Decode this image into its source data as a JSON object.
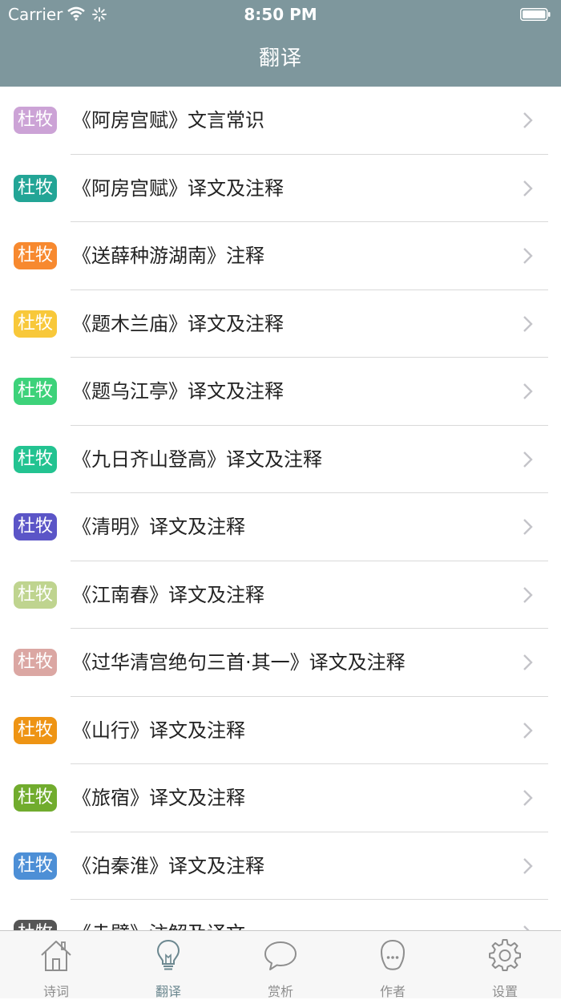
{
  "status_bar": {
    "carrier": "Carrier",
    "time": "8:50 PM"
  },
  "nav": {
    "title": "翻译"
  },
  "list": [
    {
      "tag": "杜牧",
      "color": "#cca3d6",
      "title": "《阿房宫赋》文言常识"
    },
    {
      "tag": "杜牧",
      "color": "#23a596",
      "title": "《阿房宫赋》译文及注释"
    },
    {
      "tag": "杜牧",
      "color": "#f7892f",
      "title": "《送薛种游湖南》注释"
    },
    {
      "tag": "杜牧",
      "color": "#f8c83a",
      "title": "《题木兰庙》译文及注释"
    },
    {
      "tag": "杜牧",
      "color": "#3dd27a",
      "title": "《题乌江亭》译文及注释"
    },
    {
      "tag": "杜牧",
      "color": "#23c391",
      "title": "《九日齐山登高》译文及注释"
    },
    {
      "tag": "杜牧",
      "color": "#5b55c7",
      "title": "《清明》译文及注释"
    },
    {
      "tag": "杜牧",
      "color": "#bfd48f",
      "title": "《江南春》译文及注释"
    },
    {
      "tag": "杜牧",
      "color": "#dba7a3",
      "title": "《过华清宫绝句三首·其一》译文及注释"
    },
    {
      "tag": "杜牧",
      "color": "#ee9414",
      "title": "《山行》译文及注释"
    },
    {
      "tag": "杜牧",
      "color": "#71ac2e",
      "title": "《旅宿》译文及注释"
    },
    {
      "tag": "杜牧",
      "color": "#4d8fd6",
      "title": "《泊秦淮》译文及注释"
    },
    {
      "tag": "杜牧",
      "color": "#555555",
      "title": "《赤壁》注解及译文"
    }
  ],
  "tabs": [
    {
      "label": "诗词",
      "icon": "home-icon"
    },
    {
      "label": "翻译",
      "icon": "lightbulb-icon",
      "active": true
    },
    {
      "label": "赏析",
      "icon": "chat-bubble-icon"
    },
    {
      "label": "作者",
      "icon": "person-icon"
    },
    {
      "label": "设置",
      "icon": "gear-icon"
    }
  ]
}
